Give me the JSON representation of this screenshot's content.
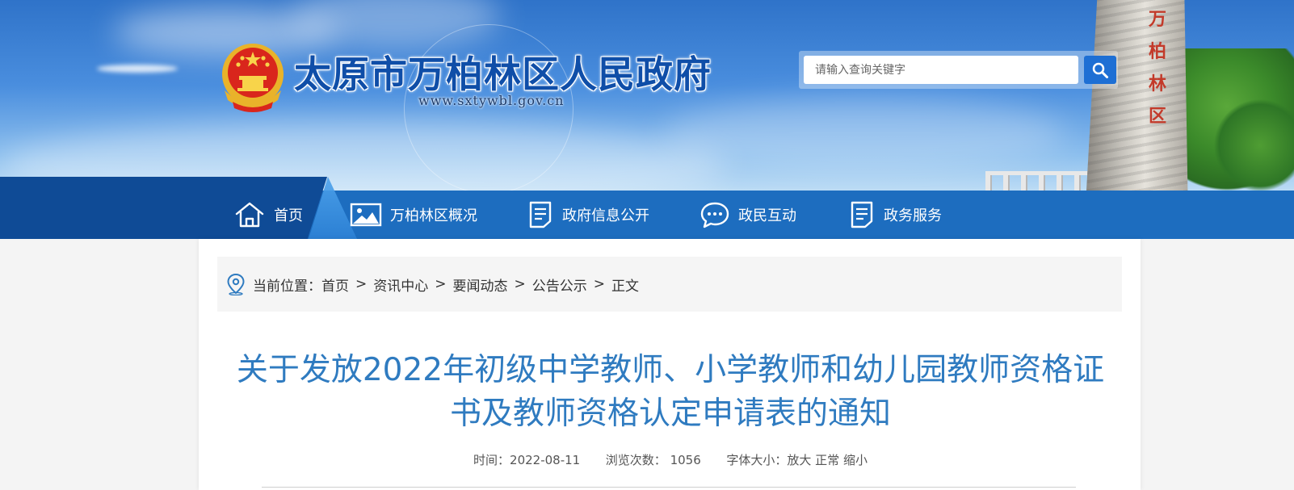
{
  "header": {
    "site_title": "太原市万柏林区人民政府",
    "site_url": "www.sxtywbl.gov.cn",
    "monument_chars": [
      "万",
      "柏",
      "林",
      "区"
    ],
    "search": {
      "placeholder": "请输入查询关键字"
    }
  },
  "nav": {
    "items": [
      {
        "label": "首页",
        "icon": "home-icon"
      },
      {
        "label": "万柏林区概况",
        "icon": "image-icon"
      },
      {
        "label": "政府信息公开",
        "icon": "document-icon"
      },
      {
        "label": "政民互动",
        "icon": "chat-icon"
      },
      {
        "label": "政务服务",
        "icon": "document-icon"
      }
    ]
  },
  "breadcrumb": {
    "prefix": "当前位置：",
    "items": [
      "首页",
      "资讯中心",
      "要闻动态",
      "公告公示",
      "正文"
    ],
    "separator": ">"
  },
  "article": {
    "title_line1": "关于发放2022年初级中学教师、小学教师和幼儿园教师资格证",
    "title_line2": "书及教师资格认定申请表的通知",
    "time_label": "时间：",
    "time_value": "2022-08-11",
    "views_label": "浏览次数：",
    "views_value": "1056",
    "font_size_label": "字体大小：",
    "font_large": "放大",
    "font_normal": "正常",
    "font_small": "缩小"
  },
  "colors": {
    "nav_bg": "#1d6dbf",
    "nav_dark": "#0f4b96",
    "title_blue": "#2f7bc0",
    "search_button": "#1e6fd4"
  }
}
